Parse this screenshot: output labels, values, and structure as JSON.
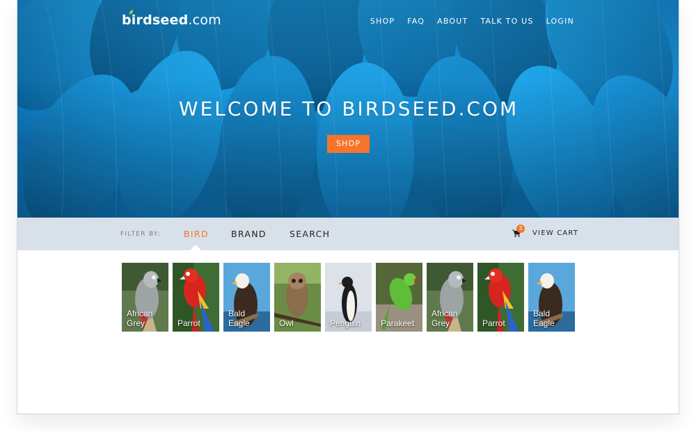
{
  "logo": {
    "bold": "birdseed",
    "rest": ".com"
  },
  "nav": {
    "items": [
      "SHOP",
      "FAQ",
      "ABOUT",
      "TALK TO US",
      "LOGIN"
    ]
  },
  "hero": {
    "title": "WELCOME TO BIRDSEED.COM",
    "button": "SHOP"
  },
  "filter": {
    "label": "FILTER BY:",
    "tabs": [
      "BIRD",
      "BRAND",
      "SEARCH"
    ],
    "active_tab": "BIRD",
    "cart_count": "3",
    "cart_label": "VIEW CART"
  },
  "birds": [
    {
      "line1": "African",
      "line2": "Grey"
    },
    {
      "line1": "Parrot",
      "line2": ""
    },
    {
      "line1": "Bald",
      "line2": "Eagle"
    },
    {
      "line1": "Owl",
      "line2": ""
    },
    {
      "line1": "Penguin",
      "line2": ""
    },
    {
      "line1": "Parakeet",
      "line2": ""
    },
    {
      "line1": "African",
      "line2": "Grey"
    },
    {
      "line1": "Parrot",
      "line2": ""
    },
    {
      "line1": "Bald",
      "line2": "Eagle"
    }
  ],
  "colors": {
    "accent": "#f6742b",
    "bar": "#e8ecf0"
  }
}
